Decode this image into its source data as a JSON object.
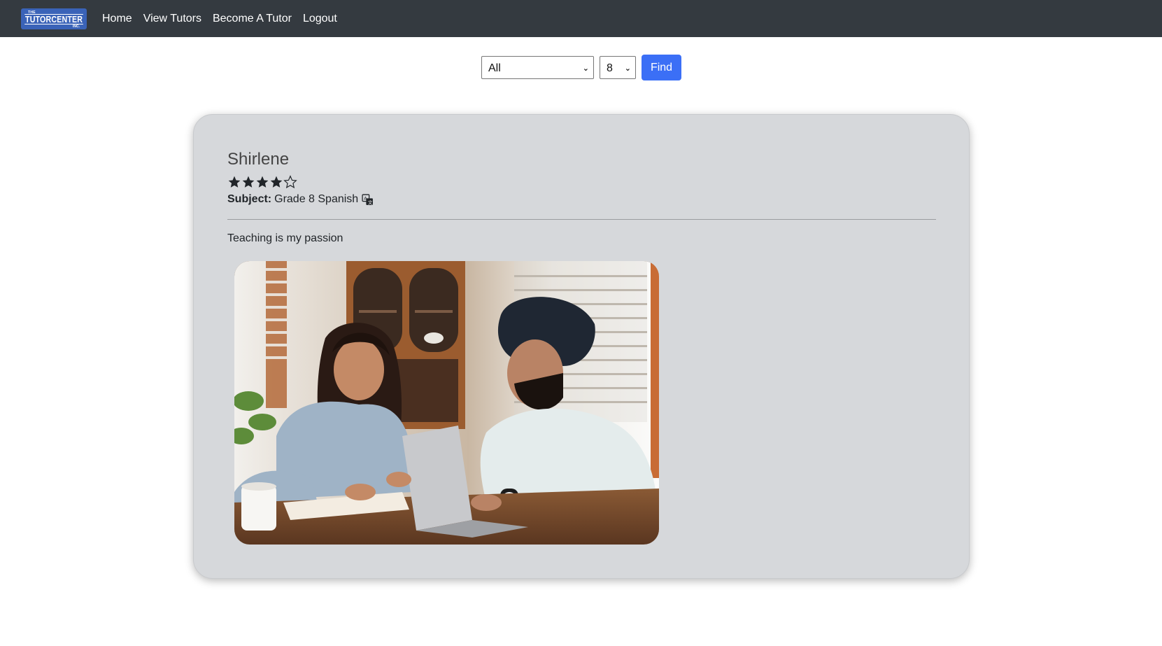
{
  "navbar": {
    "brand": {
      "top": "THE",
      "main": "TUTORCENTER",
      "bottom": "INC."
    },
    "links": [
      "Home",
      "View Tutors",
      "Become A Tutor",
      "Logout"
    ]
  },
  "filters": {
    "subject_selected": "All",
    "grade_selected": "8",
    "find_label": "Find"
  },
  "tutor": {
    "name": "Shirlene",
    "rating": 4,
    "rating_max": 5,
    "subject_label": "Subject:",
    "subject_value": "Grade 8 Spanish",
    "subject_icon": "translate-icon",
    "bio": "Teaching is my passion",
    "photo_alt": "tutor-photo"
  },
  "colors": {
    "navbar_bg": "#343a40",
    "brand_bg": "#3a63b8",
    "find_button": "#3b6ff6",
    "card_bg": "#d6d8db"
  }
}
